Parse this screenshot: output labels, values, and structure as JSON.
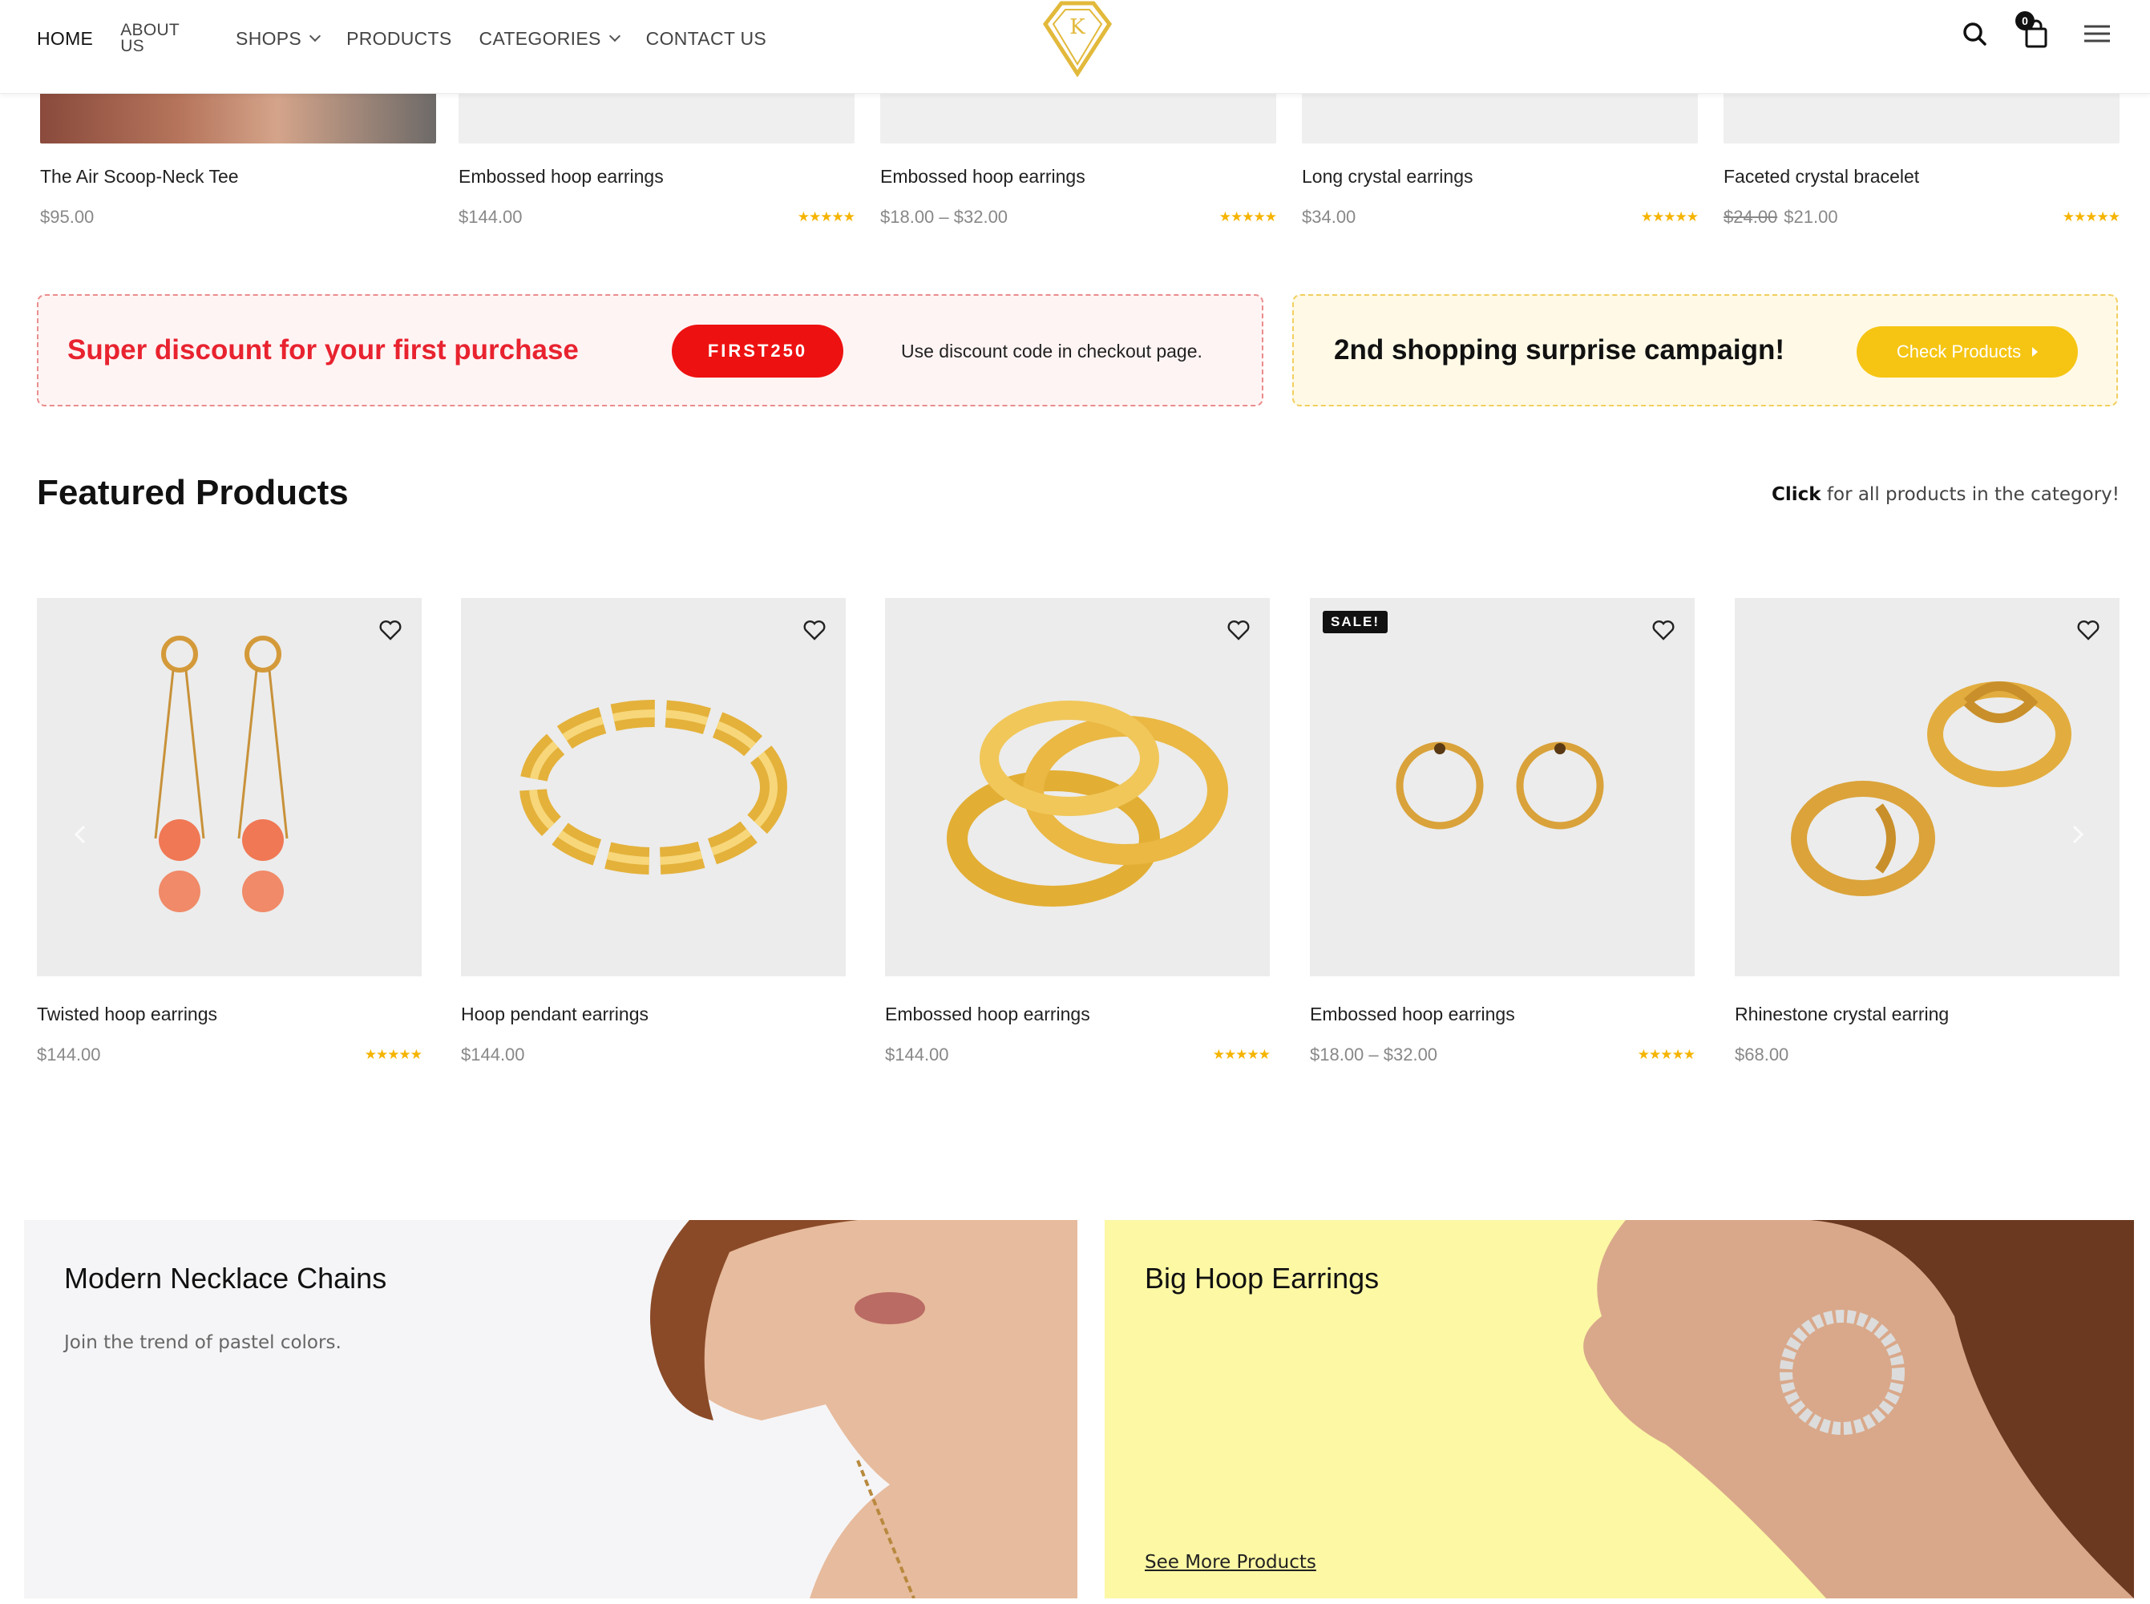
{
  "header": {
    "nav": [
      {
        "label": "HOME"
      },
      {
        "label": "ABOUT US",
        "lines": [
          "ABOUT",
          "US"
        ]
      },
      {
        "label": "SHOPS"
      },
      {
        "label": "PRODUCTS"
      },
      {
        "label": "CATEGORIES"
      },
      {
        "label": "CONTACT US"
      }
    ],
    "cart_count": "0",
    "icons": [
      "search-icon",
      "cart-icon",
      "menu-icon"
    ]
  },
  "top_products": [
    {
      "name": "The Air Scoop-Neck Tee",
      "price": "$95.00"
    },
    {
      "name": "Embossed hoop earrings",
      "price": "$144.00",
      "rating": "★★★★★"
    },
    {
      "name": "Embossed hoop earrings",
      "price": "$18.00 – $32.00",
      "rating": "★★★★★"
    },
    {
      "name": "Long crystal earrings",
      "price": "$34.00",
      "rating": "★★★★★"
    },
    {
      "name": "Faceted crystal bracelet",
      "old_price": "$24.00",
      "price": "$21.00",
      "rating": "★★★★★"
    }
  ],
  "promo": {
    "discount_title": "Super discount for your first purchase",
    "coupon_code": "FIRST250",
    "coupon_note": "Use discount code in checkout page.",
    "campaign_title": "2nd shopping surprise campaign!",
    "campaign_button": "Check Products"
  },
  "featured": {
    "title": "Featured Products",
    "link_bold": "Click",
    "link_rest": " for all products in the category!",
    "products": [
      {
        "name": "Twisted hoop earrings",
        "price": "$144.00",
        "rating": "★★★★★"
      },
      {
        "name": "Hoop pendant earrings",
        "price": "$144.00"
      },
      {
        "name": "Embossed hoop earrings",
        "price": "$144.00",
        "rating": "★★★★★"
      },
      {
        "name": "Embossed hoop earrings",
        "price": "$18.00 – $32.00",
        "rating": "★★★★★",
        "badge": "SALE!"
      },
      {
        "name": "Rhinestone crystal earring",
        "price": "$68.00"
      }
    ]
  },
  "banners": {
    "left": {
      "title": "Modern Necklace Chains",
      "subtitle": "Join the trend of pastel colors."
    },
    "right": {
      "title": "Big Hoop Earrings",
      "link": "See More Products"
    }
  },
  "colors": {
    "accent_red": "#ee1111",
    "accent_yellow": "#f6c513",
    "star": "#f5b400",
    "logo_gold": "#e2b93b"
  }
}
